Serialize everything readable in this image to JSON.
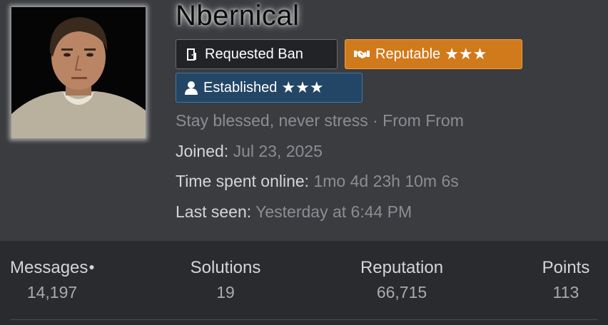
{
  "profile": {
    "username": "Nbernical",
    "badges": {
      "ban": {
        "label": "Requested Ban",
        "icon": "door-icon"
      },
      "reputable": {
        "label": "Reputable",
        "stars": "★★★",
        "icon": "handshake-icon",
        "color": "#d07a1c"
      },
      "established": {
        "label": "Established",
        "stars": "★★★",
        "icon": "user-icon",
        "color": "#234566"
      }
    },
    "tagline": "Stay blessed, never stress · From From",
    "joined": {
      "label": "Joined:",
      "value": "Jul 23, 2025"
    },
    "online": {
      "label": "Time spent online:",
      "value": "1mo 4d 23h 10m 6s"
    },
    "last_seen": {
      "label": "Last seen:",
      "value": "Yesterday at 6:44 PM"
    }
  },
  "stats": {
    "messages": {
      "label": "Messages",
      "value": "14,197"
    },
    "solutions": {
      "label": "Solutions",
      "value": "19"
    },
    "reputation": {
      "label": "Reputation",
      "value": "66,715"
    },
    "points": {
      "label": "Points",
      "value": "113"
    }
  }
}
